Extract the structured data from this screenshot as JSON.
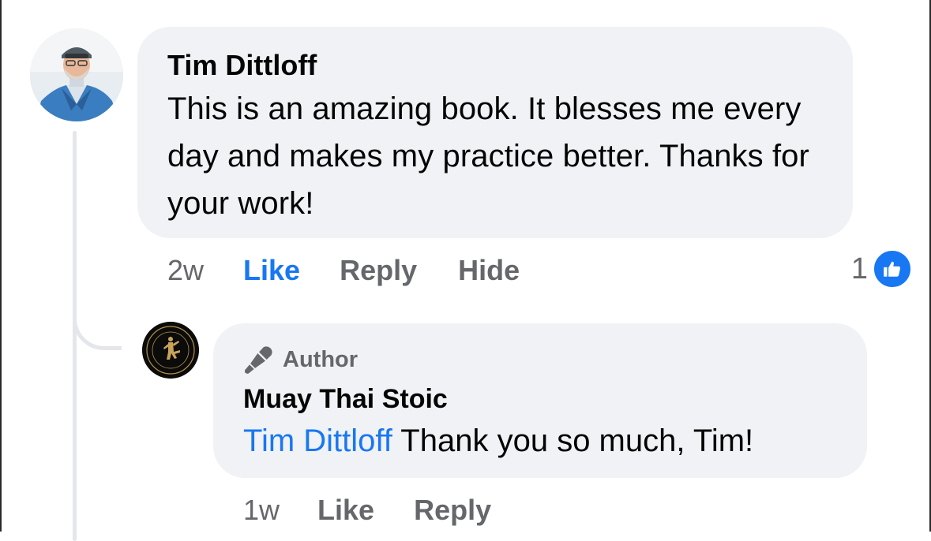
{
  "main_comment": {
    "author": "Tim Dittloff",
    "text": "This is an amazing book. It blesses me every day and makes my practice better. Thanks for your work!",
    "time": "2w",
    "actions": {
      "like": "Like",
      "reply": "Reply",
      "hide": "Hide"
    },
    "reaction_count": "1",
    "reaction_icon": "like-thumb-icon",
    "like_color": "#1877f2"
  },
  "reply": {
    "badge": "Author",
    "badge_icon": "microphone-icon",
    "author": "Muay Thai Stoic",
    "mention": "Tim Dittloff",
    "text": "Thank you so much, Tim!",
    "time": "1w",
    "actions": {
      "like": "Like",
      "reply": "Reply"
    }
  },
  "colors": {
    "bubble": "#f0f2f5",
    "link_blue": "#1877f2",
    "secondary_text": "#65676b",
    "thread_line": "#e4e6eb"
  }
}
